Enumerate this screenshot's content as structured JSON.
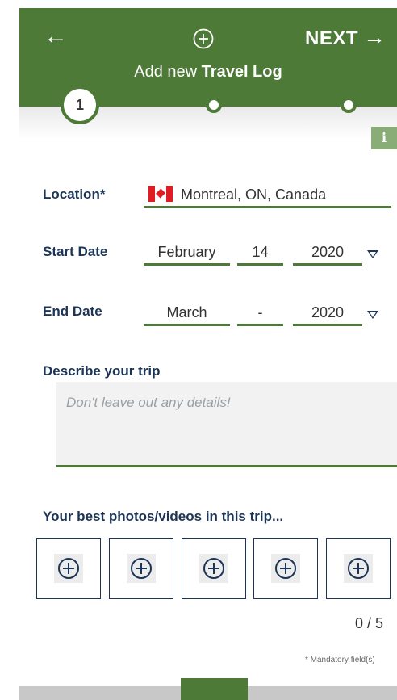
{
  "header": {
    "next_label": "NEXT",
    "title_prefix": "Add new ",
    "title_bold": "Travel Log",
    "active_step": "1"
  },
  "form": {
    "location": {
      "label": "Location*",
      "value": "Montreal, ON, Canada"
    },
    "start_date": {
      "label": "Start Date",
      "month": "February",
      "day": "14",
      "year": "2020"
    },
    "end_date": {
      "label": "End Date",
      "month": "March",
      "day": "-",
      "year": "2020"
    },
    "description": {
      "label": "Describe your trip",
      "placeholder": "Don't leave out any details!"
    },
    "photos": {
      "label": "Your best photos/videos in this trip...",
      "slot_count": 5,
      "counter": "0 / 5"
    },
    "mandatory_note": "* Mandatory field(s)"
  },
  "colors": {
    "brand_green": "#4e7a37",
    "label_navy": "#1c3557",
    "info_badge": "#8aad78"
  }
}
